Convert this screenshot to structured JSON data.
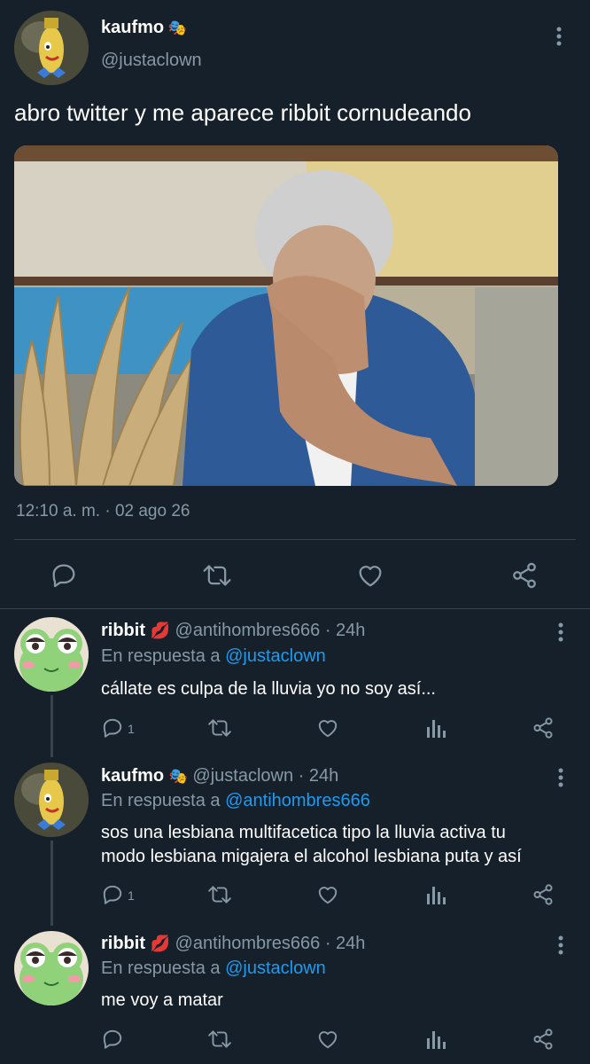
{
  "main_tweet": {
    "name": "kaufmo",
    "name_emoji": "🎭",
    "handle": "@justaclown",
    "text": "abro twitter y me aparece ribbit cornudeando",
    "timestamp": "12:10 a. m. · 02 ago 26"
  },
  "replies": [
    {
      "name": "ribbit",
      "name_emoji": "💋",
      "handle": "@antihombres666",
      "time": "· 24h",
      "reply_prefix": "En respuesta a",
      "reply_to": "@justaclown",
      "text": "cállate es culpa de la lluvia yo no soy así...",
      "reply_count": "1"
    },
    {
      "name": "kaufmo",
      "name_emoji": "🎭",
      "handle": "@justaclown",
      "time": "· 24h",
      "reply_prefix": "En respuesta a",
      "reply_to": "@antihombres666",
      "text_line1": "sos una lesbiana multifacetica tipo la lluvia activa tu",
      "text_line2": "modo lesbiana migajera el alcohol lesbiana puta y así",
      "reply_count": "1"
    },
    {
      "name": "ribbit",
      "name_emoji": "💋",
      "handle": "@antihombres666",
      "time": "· 24h",
      "reply_prefix": "En respuesta a",
      "reply_to": "@justaclown",
      "text": "me voy a matar"
    }
  ],
  "colors": {
    "background": "#15202b",
    "text": "#ffffff",
    "muted": "#8899a6",
    "link": "#1d9bf0",
    "divider": "#38444d"
  },
  "icons": [
    "more-icon",
    "reply-icon",
    "retweet-icon",
    "like-icon",
    "share-icon",
    "analytics-icon"
  ]
}
